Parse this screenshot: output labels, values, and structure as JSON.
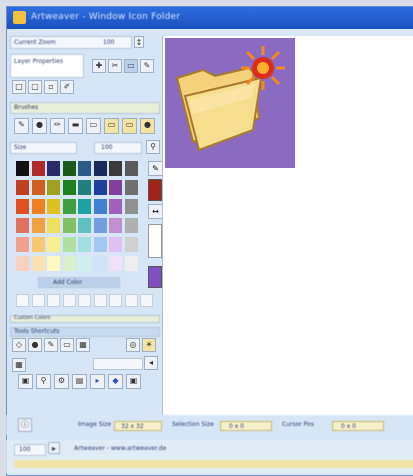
{
  "window": {
    "title": "Artweaver - Window Icon Folder"
  },
  "toolbar": {
    "zoom_label": "Current Zoom",
    "zoom_value": "100",
    "layer_label": "Layer Properties"
  },
  "brushes_label": "Brushes",
  "size_label": "Size",
  "size_value": "100",
  "palette": {
    "swatches": [
      "#111111",
      "#b02a2a",
      "#2a2a6a",
      "#1a5a1a",
      "#2a5a8a",
      "#1a2a5a",
      "#3a3a3a",
      "#5a5a5a",
      "#c04020",
      "#d06020",
      "#a0a020",
      "#208020",
      "#208080",
      "#2040a0",
      "#8040a0",
      "#707070",
      "#e05020",
      "#f08020",
      "#e0c020",
      "#40a040",
      "#20a0a0",
      "#4080d0",
      "#a060c0",
      "#909090",
      "#e07060",
      "#f0a040",
      "#f0e060",
      "#80c060",
      "#60c0c0",
      "#70a0e0",
      "#c090d0",
      "#b0b0b0",
      "#f0a090",
      "#f8c870",
      "#f8f090",
      "#b0e0a0",
      "#a0e0e0",
      "#a0c8f0",
      "#e0c0f0",
      "#d0d0d0",
      "#f8d0c0",
      "#fce0b0",
      "#fcf8c0",
      "#d8f0d0",
      "#d0f0f0",
      "#d0e4f8",
      "#f0e0f8",
      "#eeeeee"
    ],
    "fg_color": "#a0241a",
    "bg_color": "#8050c0",
    "add_label": "Add Color"
  },
  "custom_label": "Custom Colors",
  "shortcuts_label": "Tools Shortcuts",
  "status": {
    "label1": "Image Size",
    "value1": "32 x 32",
    "label2": "Selection Size",
    "value2": "0 x 0",
    "label3": "Cursor Pos",
    "value3": "0 x 0"
  },
  "bottom": {
    "zoom": "100",
    "text": "Artweaver - www.artweaver.de"
  }
}
